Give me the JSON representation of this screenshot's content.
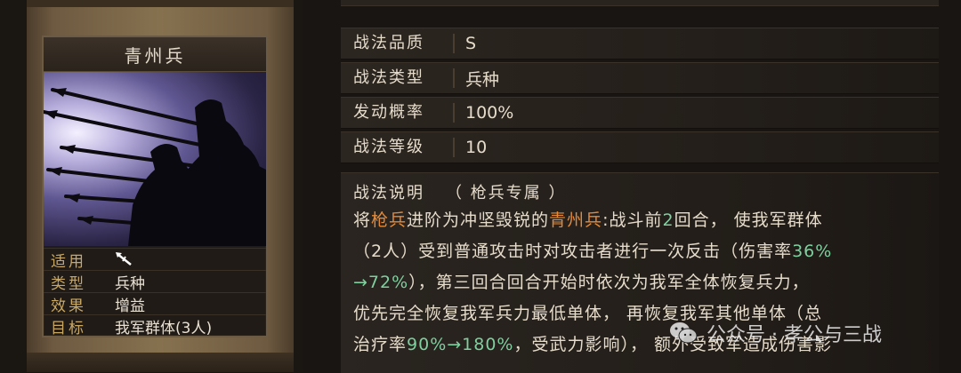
{
  "card": {
    "title": "青州兵",
    "attributes": [
      {
        "key": "适用",
        "value": ""
      },
      {
        "key": "类型",
        "value": "兵种"
      },
      {
        "key": "效果",
        "value": "增益"
      },
      {
        "key": "目标",
        "value": "我军群体(3人)"
      }
    ]
  },
  "info": [
    {
      "key": "战法品质",
      "value": "S"
    },
    {
      "key": "战法类型",
      "value": "兵种"
    },
    {
      "key": "发动概率",
      "value": "100%"
    },
    {
      "key": "战法等级",
      "value": "10"
    }
  ],
  "description": {
    "label": "战法说明",
    "note": "（ 枪兵专属 ）",
    "line1": [
      "将",
      "枪兵",
      "进阶为冲坚毁锐的",
      "青州兵",
      ":战斗前",
      "2",
      "回合， 使我军群体"
    ],
    "line2": [
      "（2人）受到普通攻击时对攻击者进行一次反击（伤害率",
      "36%"
    ],
    "line3": [
      "→72%",
      "），第三回合回合开始时依次为我军全体恢复兵力，"
    ],
    "line4": "优先完全恢复我军兵力最低单体， 再恢复我军其他单体（总",
    "line5": [
      "治疗率",
      "90%→180%",
      "，受武力影响）， 额外受致军造成伤害影"
    ]
  },
  "watermark": {
    "text": "公众号 · 孝公与三战",
    "icon": "wechat-icon"
  },
  "colors": {
    "highlight_orange": "#e38a3a",
    "highlight_green": "#7fcf9f",
    "label_gold": "#c9a865"
  }
}
